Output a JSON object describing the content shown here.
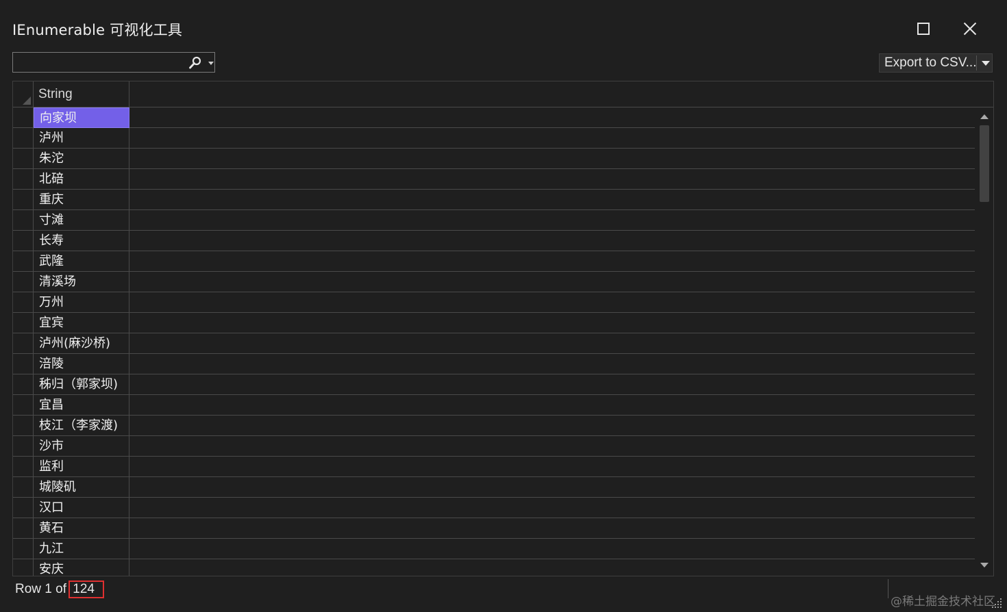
{
  "window": {
    "title": "IEnumerable 可视化工具",
    "maximize_icon": "maximize-icon",
    "close_icon": "close-icon"
  },
  "toolbar": {
    "search": {
      "value": "",
      "placeholder": ""
    },
    "search_icon": "search-icon",
    "export_label": "Export to CSV..."
  },
  "grid": {
    "column_header": "String",
    "selected_row": 1,
    "rows": [
      "向家坝",
      "泸州",
      "朱沱",
      "北碚",
      "重庆",
      "寸滩",
      "长寿",
      "武隆",
      "清溪场",
      "万州",
      "宜宾",
      "泸州(麻沙桥)",
      "涪陵",
      "秭归（郭家坝)",
      "宜昌",
      "枝江（李家渡)",
      "沙市",
      "监利",
      "城陵矶",
      "汉口",
      "黄石",
      "九江",
      "安庆"
    ]
  },
  "status": {
    "row_prefix": "Row 1 of",
    "total": "124"
  },
  "watermark": "@稀土掘金技术社区",
  "colors": {
    "background": "#1f1f1f",
    "selection": "#7360e8",
    "highlight_box": "#e03030"
  }
}
